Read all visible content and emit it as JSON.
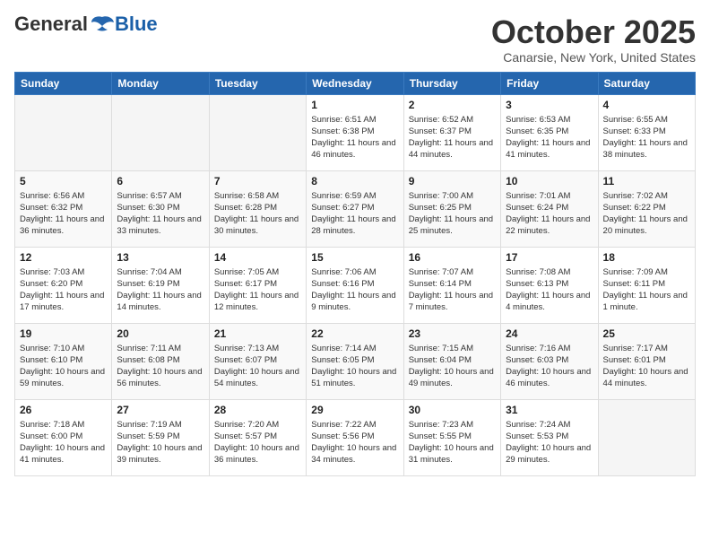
{
  "header": {
    "logo": {
      "general": "General",
      "blue": "Blue"
    },
    "title": "October 2025",
    "location": "Canarsie, New York, United States"
  },
  "calendar": {
    "days_of_week": [
      "Sunday",
      "Monday",
      "Tuesday",
      "Wednesday",
      "Thursday",
      "Friday",
      "Saturday"
    ],
    "weeks": [
      {
        "days": [
          {
            "empty": true
          },
          {
            "empty": true
          },
          {
            "empty": true
          },
          {
            "number": "1",
            "sunrise": "Sunrise: 6:51 AM",
            "sunset": "Sunset: 6:38 PM",
            "daylight": "Daylight: 11 hours and 46 minutes."
          },
          {
            "number": "2",
            "sunrise": "Sunrise: 6:52 AM",
            "sunset": "Sunset: 6:37 PM",
            "daylight": "Daylight: 11 hours and 44 minutes."
          },
          {
            "number": "3",
            "sunrise": "Sunrise: 6:53 AM",
            "sunset": "Sunset: 6:35 PM",
            "daylight": "Daylight: 11 hours and 41 minutes."
          },
          {
            "number": "4",
            "sunrise": "Sunrise: 6:55 AM",
            "sunset": "Sunset: 6:33 PM",
            "daylight": "Daylight: 11 hours and 38 minutes."
          }
        ]
      },
      {
        "days": [
          {
            "number": "5",
            "sunrise": "Sunrise: 6:56 AM",
            "sunset": "Sunset: 6:32 PM",
            "daylight": "Daylight: 11 hours and 36 minutes."
          },
          {
            "number": "6",
            "sunrise": "Sunrise: 6:57 AM",
            "sunset": "Sunset: 6:30 PM",
            "daylight": "Daylight: 11 hours and 33 minutes."
          },
          {
            "number": "7",
            "sunrise": "Sunrise: 6:58 AM",
            "sunset": "Sunset: 6:28 PM",
            "daylight": "Daylight: 11 hours and 30 minutes."
          },
          {
            "number": "8",
            "sunrise": "Sunrise: 6:59 AM",
            "sunset": "Sunset: 6:27 PM",
            "daylight": "Daylight: 11 hours and 28 minutes."
          },
          {
            "number": "9",
            "sunrise": "Sunrise: 7:00 AM",
            "sunset": "Sunset: 6:25 PM",
            "daylight": "Daylight: 11 hours and 25 minutes."
          },
          {
            "number": "10",
            "sunrise": "Sunrise: 7:01 AM",
            "sunset": "Sunset: 6:24 PM",
            "daylight": "Daylight: 11 hours and 22 minutes."
          },
          {
            "number": "11",
            "sunrise": "Sunrise: 7:02 AM",
            "sunset": "Sunset: 6:22 PM",
            "daylight": "Daylight: 11 hours and 20 minutes."
          }
        ]
      },
      {
        "days": [
          {
            "number": "12",
            "sunrise": "Sunrise: 7:03 AM",
            "sunset": "Sunset: 6:20 PM",
            "daylight": "Daylight: 11 hours and 17 minutes."
          },
          {
            "number": "13",
            "sunrise": "Sunrise: 7:04 AM",
            "sunset": "Sunset: 6:19 PM",
            "daylight": "Daylight: 11 hours and 14 minutes."
          },
          {
            "number": "14",
            "sunrise": "Sunrise: 7:05 AM",
            "sunset": "Sunset: 6:17 PM",
            "daylight": "Daylight: 11 hours and 12 minutes."
          },
          {
            "number": "15",
            "sunrise": "Sunrise: 7:06 AM",
            "sunset": "Sunset: 6:16 PM",
            "daylight": "Daylight: 11 hours and 9 minutes."
          },
          {
            "number": "16",
            "sunrise": "Sunrise: 7:07 AM",
            "sunset": "Sunset: 6:14 PM",
            "daylight": "Daylight: 11 hours and 7 minutes."
          },
          {
            "number": "17",
            "sunrise": "Sunrise: 7:08 AM",
            "sunset": "Sunset: 6:13 PM",
            "daylight": "Daylight: 11 hours and 4 minutes."
          },
          {
            "number": "18",
            "sunrise": "Sunrise: 7:09 AM",
            "sunset": "Sunset: 6:11 PM",
            "daylight": "Daylight: 11 hours and 1 minute."
          }
        ]
      },
      {
        "days": [
          {
            "number": "19",
            "sunrise": "Sunrise: 7:10 AM",
            "sunset": "Sunset: 6:10 PM",
            "daylight": "Daylight: 10 hours and 59 minutes."
          },
          {
            "number": "20",
            "sunrise": "Sunrise: 7:11 AM",
            "sunset": "Sunset: 6:08 PM",
            "daylight": "Daylight: 10 hours and 56 minutes."
          },
          {
            "number": "21",
            "sunrise": "Sunrise: 7:13 AM",
            "sunset": "Sunset: 6:07 PM",
            "daylight": "Daylight: 10 hours and 54 minutes."
          },
          {
            "number": "22",
            "sunrise": "Sunrise: 7:14 AM",
            "sunset": "Sunset: 6:05 PM",
            "daylight": "Daylight: 10 hours and 51 minutes."
          },
          {
            "number": "23",
            "sunrise": "Sunrise: 7:15 AM",
            "sunset": "Sunset: 6:04 PM",
            "daylight": "Daylight: 10 hours and 49 minutes."
          },
          {
            "number": "24",
            "sunrise": "Sunrise: 7:16 AM",
            "sunset": "Sunset: 6:03 PM",
            "daylight": "Daylight: 10 hours and 46 minutes."
          },
          {
            "number": "25",
            "sunrise": "Sunrise: 7:17 AM",
            "sunset": "Sunset: 6:01 PM",
            "daylight": "Daylight: 10 hours and 44 minutes."
          }
        ]
      },
      {
        "days": [
          {
            "number": "26",
            "sunrise": "Sunrise: 7:18 AM",
            "sunset": "Sunset: 6:00 PM",
            "daylight": "Daylight: 10 hours and 41 minutes."
          },
          {
            "number": "27",
            "sunrise": "Sunrise: 7:19 AM",
            "sunset": "Sunset: 5:59 PM",
            "daylight": "Daylight: 10 hours and 39 minutes."
          },
          {
            "number": "28",
            "sunrise": "Sunrise: 7:20 AM",
            "sunset": "Sunset: 5:57 PM",
            "daylight": "Daylight: 10 hours and 36 minutes."
          },
          {
            "number": "29",
            "sunrise": "Sunrise: 7:22 AM",
            "sunset": "Sunset: 5:56 PM",
            "daylight": "Daylight: 10 hours and 34 minutes."
          },
          {
            "number": "30",
            "sunrise": "Sunrise: 7:23 AM",
            "sunset": "Sunset: 5:55 PM",
            "daylight": "Daylight: 10 hours and 31 minutes."
          },
          {
            "number": "31",
            "sunrise": "Sunrise: 7:24 AM",
            "sunset": "Sunset: 5:53 PM",
            "daylight": "Daylight: 10 hours and 29 minutes."
          },
          {
            "empty": true
          }
        ]
      }
    ]
  }
}
